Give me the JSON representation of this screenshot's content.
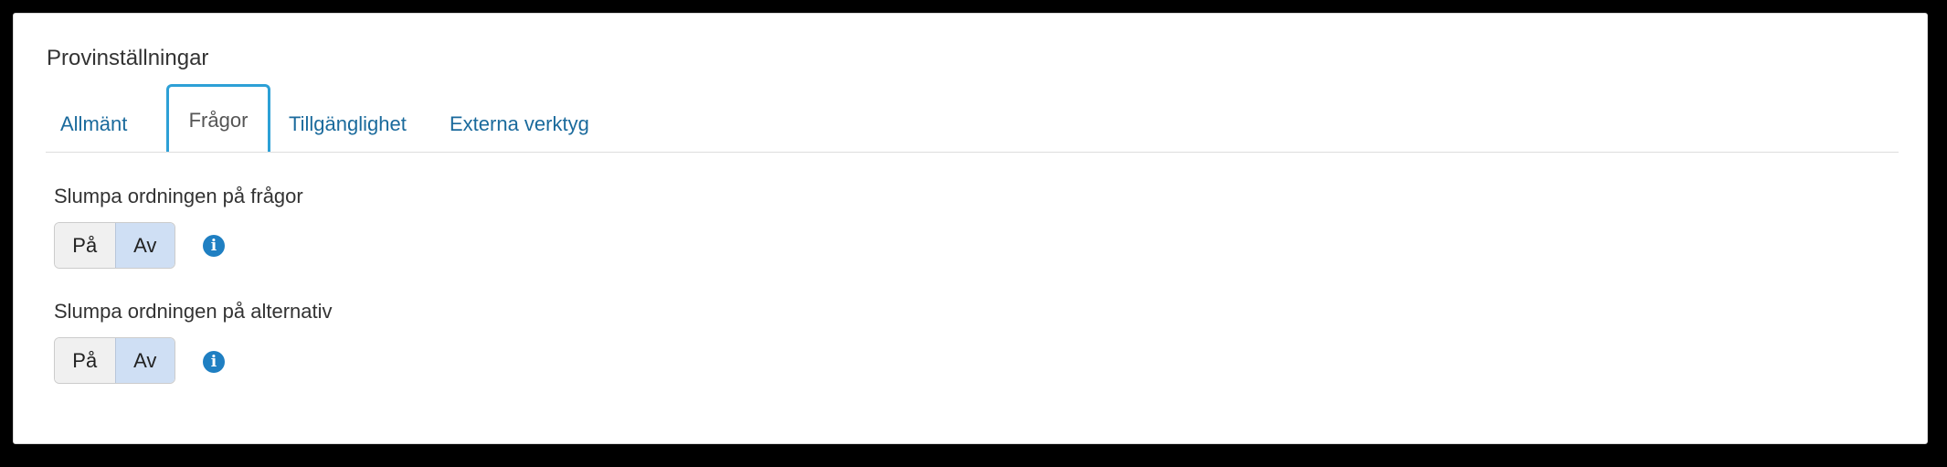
{
  "page": {
    "title": "Provinställningar"
  },
  "tabs": [
    {
      "label": "Allmänt",
      "active": false
    },
    {
      "label": "Frågor",
      "active": true
    },
    {
      "label": "Tillgänglighet",
      "active": false
    },
    {
      "label": "Externa verktyg",
      "active": false
    }
  ],
  "settings": [
    {
      "label": "Slumpa ordningen på frågor",
      "on_label": "På",
      "off_label": "Av",
      "value": "Av",
      "info_icon": "info-circle-icon"
    },
    {
      "label": "Slumpa ordningen på alternativ",
      "on_label": "På",
      "off_label": "Av",
      "value": "Av",
      "info_icon": "info-circle-icon"
    }
  ],
  "colors": {
    "tab_link": "#1a6a9c",
    "active_tab_border": "#2da0d6",
    "selected_toggle": "#cfdff4",
    "info_icon": "#1f7fc2"
  }
}
